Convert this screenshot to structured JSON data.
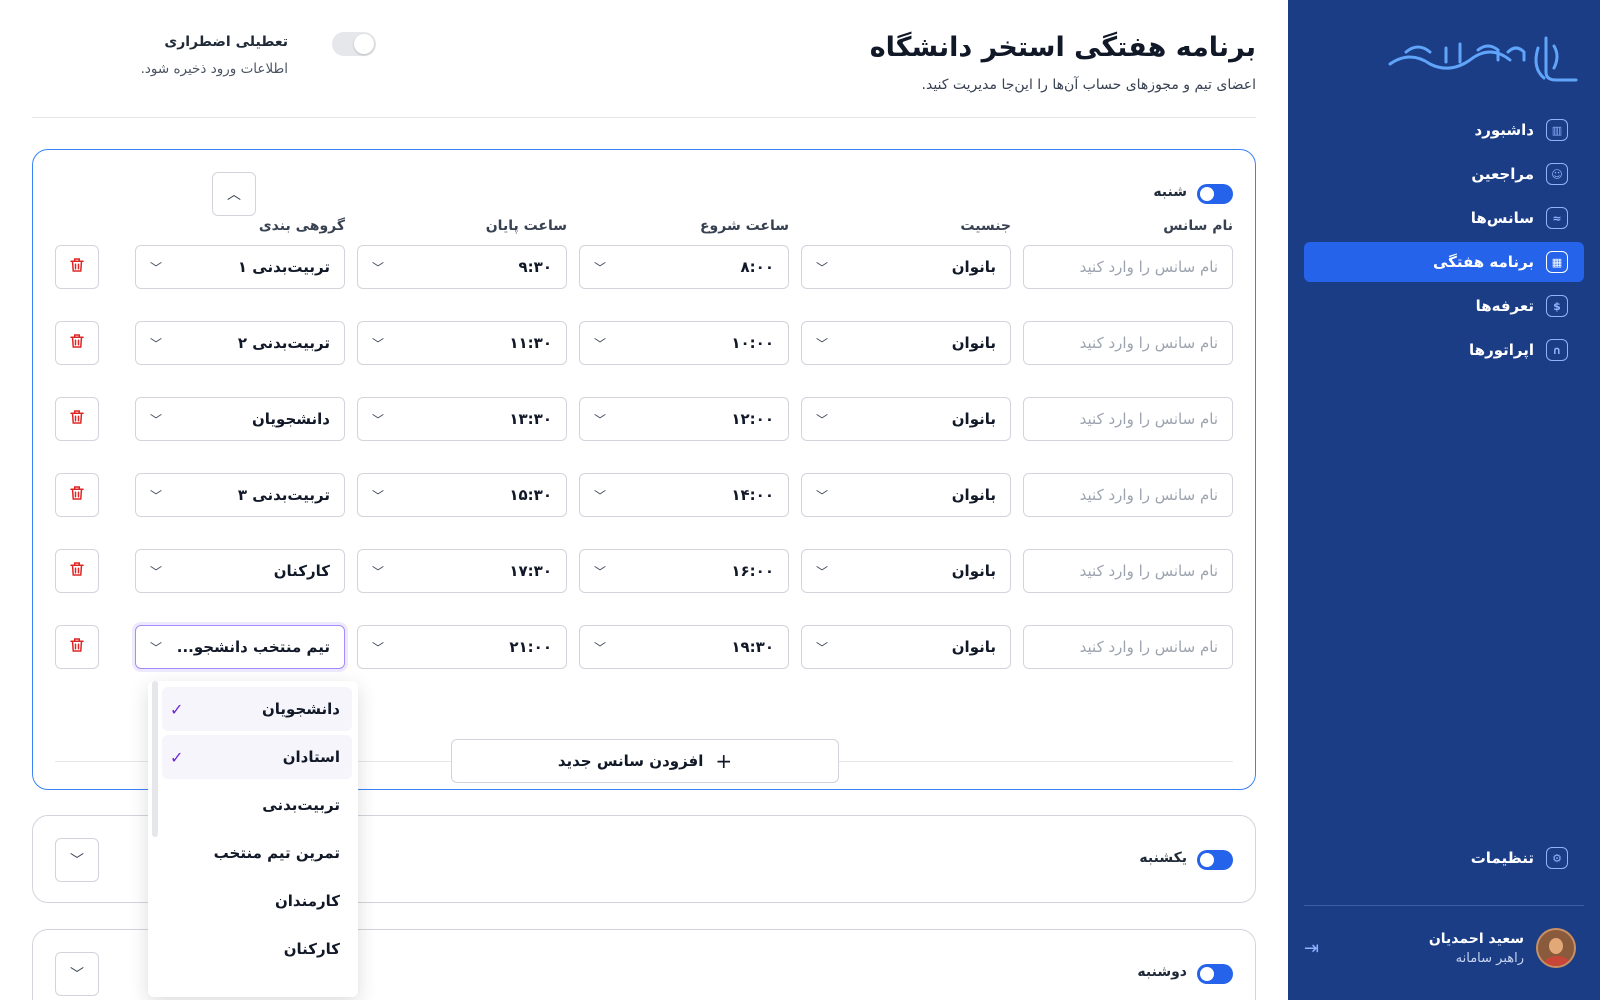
{
  "sidebar": {
    "logo_text": "دانشگاه تبریز",
    "items": [
      {
        "label": "داشبورد",
        "icon": "dashboard-icon"
      },
      {
        "label": "مراجعین",
        "icon": "user-icon"
      },
      {
        "label": "سانس‌ها",
        "icon": "swimmer-icon"
      },
      {
        "label": "برنامه هفتگی",
        "icon": "calendar-icon",
        "active": true
      },
      {
        "label": "تعرفه‌ها",
        "icon": "tariff-icon"
      },
      {
        "label": "اپراتورها",
        "icon": "headset-icon"
      }
    ],
    "settings_label": "تنظیمات",
    "user": {
      "name": "سعید احمدیان",
      "role": "راهبر سامانه"
    }
  },
  "header": {
    "title": "برنامه هفتگی استخر دانشگاه",
    "subtitle": "اعضای تیم و مجوزهای حساب آن‌ها را این‌جا مدیریت کنید.",
    "emergency_label": "تعطیلی اضطراری",
    "emergency_sub": "اطلاعات ورود ذخیره شود."
  },
  "columns": {
    "name": "نام سانس",
    "gender": "جنسیت",
    "start": "ساعت شروع",
    "end": "ساعت پایان",
    "group": "گروهی بندی"
  },
  "days": [
    {
      "name": "شنبه",
      "enabled": true,
      "expanded": true
    },
    {
      "name": "یکشنبه",
      "enabled": true,
      "expanded": false
    },
    {
      "name": "دوشنبه",
      "enabled": true,
      "expanded": false
    }
  ],
  "name_placeholder": "نام سانس را وارد کنید",
  "sessions": [
    {
      "gender": "بانوان",
      "start": "۸:۰۰",
      "end": "۹:۳۰",
      "group": "تربیت‌بدنی ۱"
    },
    {
      "gender": "بانوان",
      "start": "۱۰:۰۰",
      "end": "۱۱:۳۰",
      "group": "تربیت‌بدنی ۲"
    },
    {
      "gender": "بانوان",
      "start": "۱۲:۰۰",
      "end": "۱۳:۳۰",
      "group": "دانشجویان"
    },
    {
      "gender": "بانوان",
      "start": "۱۴:۰۰",
      "end": "۱۵:۳۰",
      "group": "تربیت‌بدنی ۳"
    },
    {
      "gender": "بانوان",
      "start": "۱۶:۰۰",
      "end": "۱۷:۳۰",
      "group": "کارکنان"
    },
    {
      "gender": "بانوان",
      "start": "۱۹:۳۰",
      "end": "۲۱:۰۰",
      "group": "تیم منتخب دانشجو..."
    }
  ],
  "add_session_label": "افزودن سانس جدید",
  "group_dropdown": [
    {
      "label": "دانشجویان",
      "checked": true
    },
    {
      "label": "استادان",
      "checked": true
    },
    {
      "label": "تربیت‌بدنی",
      "checked": false
    },
    {
      "label": "تمرین تیم منتخب",
      "checked": false
    },
    {
      "label": "کارمندان",
      "checked": false
    },
    {
      "label": "کارکنان",
      "checked": false
    }
  ],
  "colors": {
    "sidebar": "#1b3d86",
    "accent": "#2563eb",
    "danger": "#dc2626",
    "check": "#6d28d9"
  }
}
